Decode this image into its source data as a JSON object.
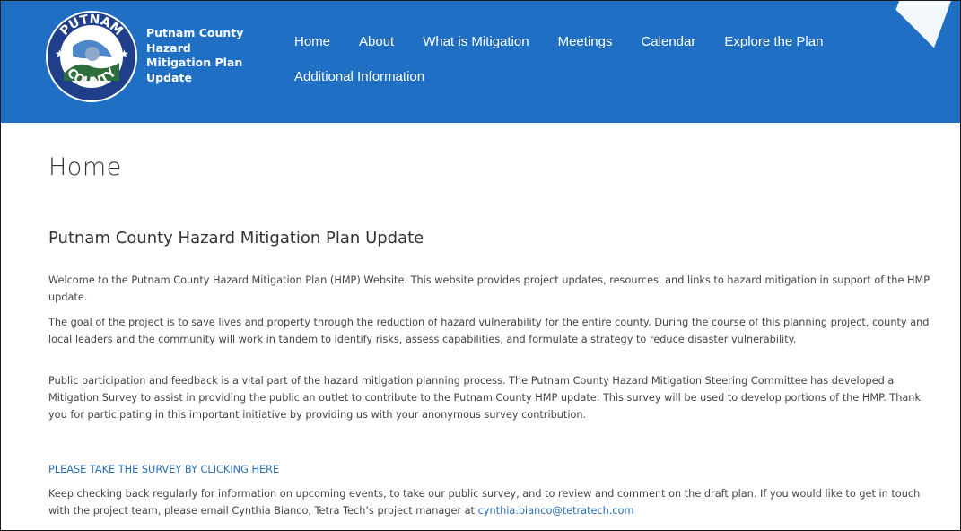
{
  "header": {
    "site_title": "Putnam County Hazard Mitigation Plan Update",
    "logo": {
      "top_text": "PUTNAM",
      "bottom_text": "COUNTY"
    }
  },
  "nav": {
    "row1": [
      "Home",
      "About",
      "What is Mitigation",
      "Meetings",
      "Calendar",
      "Explore the Plan"
    ],
    "row2": [
      "Additional Information"
    ]
  },
  "main": {
    "title": "Home",
    "subtitle": "Putnam County Hazard Mitigation Plan Update",
    "p1": "Welcome to the Putnam County Hazard Mitigation Plan (HMP) Website. This website provides project updates, resources, and links to hazard mitigation in support of the HMP update.",
    "p2": "The goal of the project is to save lives and property through the reduction of hazard vulnerability for the entire county. During the course of this planning project, county and local leaders and the community will work in tandem to identify risks, assess capabilities, and formulate a strategy to reduce disaster vulnerability.",
    "p3": "Public participation and feedback is a vital part of the hazard mitigation planning process. The Putnam County Hazard Mitigation Steering Committee has developed a Mitigation Survey to assist in providing the public an outlet to contribute to the Putnam County HMP update. This survey will be used to develop portions of the HMP. Thank you for participating in this important initiative by providing us with your anonymous survey contribution.",
    "survey_link": "PLEASE TAKE THE SURVEY BY CLICKING HERE",
    "p5_text": "Keep checking back regularly for information on upcoming events, to take our public survey, and to review and comment on the draft plan. If you would like to get in touch with the project team, please email Cynthia Bianco, Tetra Tech’s project manager at",
    "p5_email": "cynthia.bianco@tetratech.com"
  },
  "colors": {
    "header_bg": "#1f6fc5",
    "link": "#2a6db4"
  }
}
